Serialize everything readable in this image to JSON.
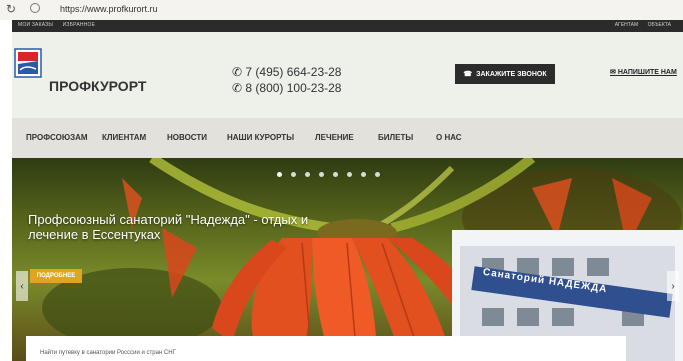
{
  "browser": {
    "url": "https://www.profkurort.ru"
  },
  "topstrip": {
    "left_links": [
      "МОИ ЗАКАЗЫ",
      "ИЗБРАННОЕ"
    ],
    "right_links": [
      "АГЕНТАМ",
      "ОБЪЕКТА"
    ]
  },
  "header": {
    "brand": "ПРОФКУРОРТ",
    "phones": [
      "7 (495) 664-23-28",
      "8 (800) 100-23-28"
    ],
    "callback_label": "ЗАКАЖИТЕ ЗВОНОК",
    "write_label": "НАПИШИТЕ НАМ"
  },
  "nav": {
    "items": [
      "ПРОФСОЮЗАМ",
      "КЛИЕНТАМ",
      "НОВОСТИ",
      "НАШИ КУРОРТЫ",
      "ЛЕЧЕНИЕ",
      "БИЛЕТЫ",
      "О НАС"
    ]
  },
  "hero": {
    "title": "Профсоюзный санаторий \"Надежда\" - отдых и лечение в Ессентуках",
    "button_label": "ПОДРОБНЕЕ",
    "building_sign": "Санаторий НАДЕЖДА",
    "slide_count": 8,
    "active_slide": 1
  },
  "search": {
    "text": "Найти путевку в санатории Росссии и стран СНГ"
  },
  "colors": {
    "accent": "#e0a422",
    "dark": "#2b2b2b",
    "flower": "#e2501f"
  }
}
